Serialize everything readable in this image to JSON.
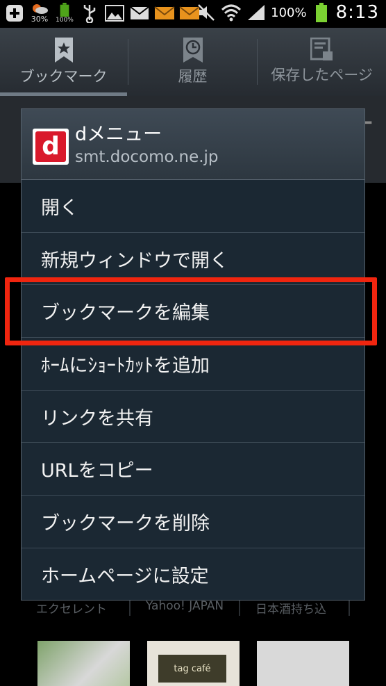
{
  "status_bar": {
    "battery_small_pct": "30%",
    "battery_small_pct2": "100%",
    "battery_pct": "100%",
    "time": "8:13"
  },
  "tabs": [
    {
      "label": "ブックマーク",
      "icon": "bookmark-star-icon",
      "active": true
    },
    {
      "label": "履歴",
      "icon": "history-clock-icon",
      "active": false
    },
    {
      "label": "保存したページ",
      "icon": "saved-page-icon",
      "active": false
    }
  ],
  "background": {
    "labels": [
      "エクセレント",
      "Yahoo! JAPAN",
      "日本酒持ち込"
    ],
    "thumb2_text": "tag café"
  },
  "dialog": {
    "title": "dメニュー",
    "url": "smt.docomo.ne.jp",
    "favicon_letter": "d",
    "menu": [
      "開く",
      "新規ウィンドウで開く",
      "ブックマークを編集",
      "ﾎｰﾑにｼｮｰﾄｶｯﾄを追加",
      "リンクを共有",
      "URLをコピー",
      "ブックマークを削除",
      "ホームページに設定"
    ]
  },
  "colors": {
    "highlight": "#f0250f",
    "favicon_red": "#d9192b",
    "dialog_bg": "#1b2833"
  }
}
